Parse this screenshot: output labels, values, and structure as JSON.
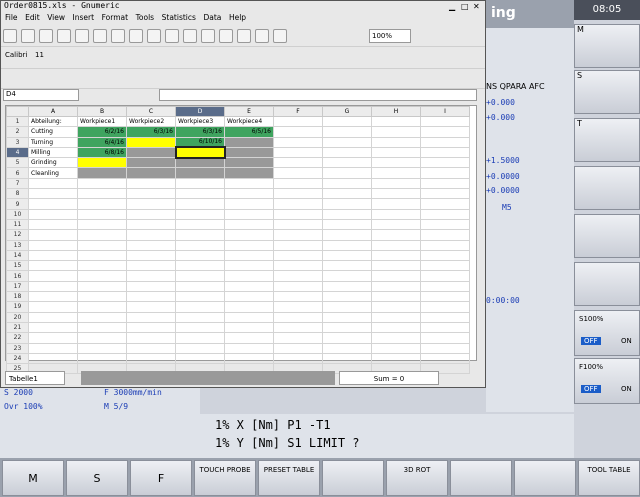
{
  "title": "Order0815.xls - Gnumeric",
  "menu": [
    "File",
    "Edit",
    "View",
    "Insert",
    "Format",
    "Tools",
    "Statistics",
    "Data",
    "Help"
  ],
  "zoom": "100%",
  "font": "Calibri",
  "font_size": "11",
  "cell_ref": "D4",
  "cols": [
    "A",
    "B",
    "C",
    "D",
    "E",
    "F",
    "G",
    "H",
    "I"
  ],
  "rows": [
    "1",
    "2",
    "3",
    "4",
    "5",
    "6",
    "7",
    "8",
    "9",
    "10",
    "11",
    "12",
    "13",
    "14",
    "15",
    "16",
    "17",
    "18",
    "19",
    "20",
    "21",
    "22",
    "23",
    "24",
    "25"
  ],
  "data": {
    "a1": "Abteilung:",
    "b1": "Workpiece1",
    "c1": "Workpiece2",
    "d1": "Workpiece3",
    "e1": "Workpiece4",
    "a2": "Cutting",
    "b2": "6/2/16",
    "c2": "6/3/16",
    "d2": "6/3/16",
    "e2": "6/5/16",
    "a3": "Turning",
    "b3": "6/4/16",
    "d3": "6/10/16",
    "a4": "Milling",
    "a5": "Grinding",
    "b4": "6/8/16",
    "a6": "Cleanling"
  },
  "sheet_tab": "Tabelle1",
  "sum": "Sum = 0",
  "right_time": "08:05",
  "side": [
    "M",
    "S",
    "T"
  ],
  "s100": "S100%",
  "off": "OFF",
  "on": "ON",
  "f100": "F100%",
  "nc": {
    "qpara": "NS QPARA AFC",
    "v1": "+0.000",
    "v2": "+0.000",
    "v3": "+1.5000",
    "v4": "+0.0000",
    "v5": "+0.0000",
    "m5": "M5",
    "time": "0:00:00"
  },
  "status": {
    "s": "S 2000",
    "f": "F 3000mm/min",
    "ovr": "Ovr 100%",
    "m": "M 5/9"
  },
  "line1": "1% X [Nm]  P1  -T1",
  "line2": "1% Y [Nm]  S1  LIMIT ?",
  "keys": [
    "M",
    "S",
    "F",
    "TOUCH PROBE",
    "PRESET TABLE",
    "",
    "3D ROT",
    "",
    "",
    "TOOL TABLE"
  ],
  "ing": "ing"
}
